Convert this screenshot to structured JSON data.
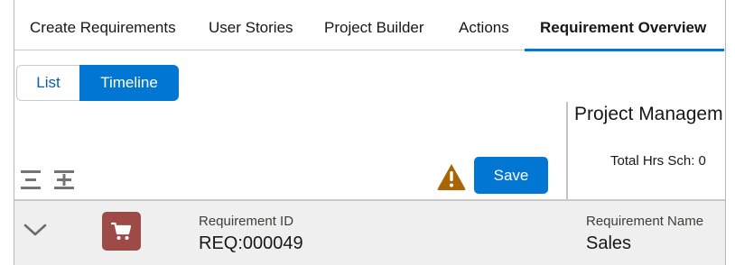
{
  "tabs": [
    {
      "label": "Create Requirements"
    },
    {
      "label": "User Stories"
    },
    {
      "label": "Project Builder"
    },
    {
      "label": "Actions"
    },
    {
      "label": "Requirement Overview",
      "active": true
    }
  ],
  "view_toggle": {
    "list_label": "List",
    "timeline_label": "Timeline",
    "selected": "Timeline"
  },
  "panel": {
    "title": "Project Managem",
    "total_hrs": "Total Hrs Sch: 0"
  },
  "toolbar": {
    "save_label": "Save",
    "warning_icon": "warning-icon",
    "collapse_icon": "collapse-all-icon",
    "expand_icon": "expand-all-icon"
  },
  "row": {
    "id_label": "Requirement ID",
    "id_value": "REQ:000049",
    "name_label": "Requirement Name",
    "name_value": "Sales",
    "icon": "cart-icon"
  },
  "colors": {
    "accent": "#0176d3",
    "warning": "#a96404",
    "cart_tile": "#9e4b47",
    "row_bg": "#efefef"
  }
}
